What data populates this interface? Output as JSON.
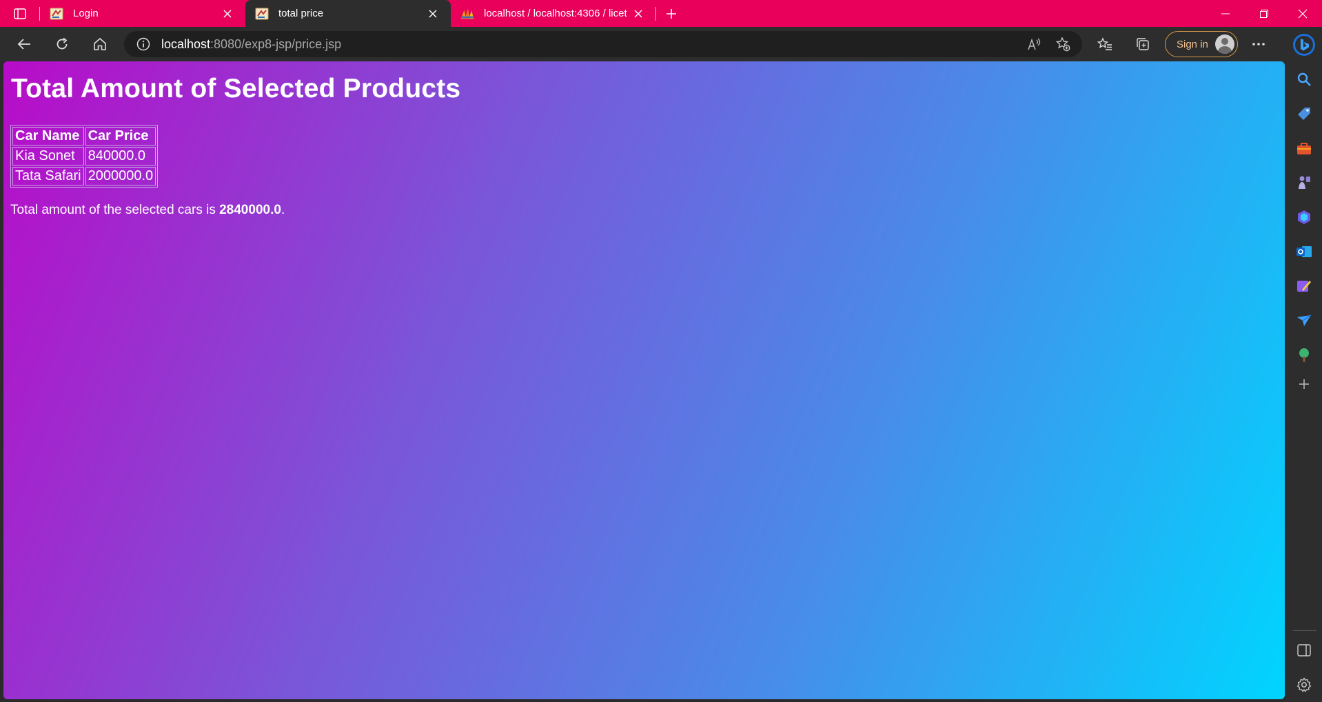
{
  "browser": {
    "tabs": [
      {
        "title": "Login",
        "favicon": "java-cup-icon",
        "active": false
      },
      {
        "title": "total price",
        "favicon": "java-cup-icon",
        "active": true
      },
      {
        "title": "localhost / localhost:4306 / licet /",
        "favicon": "phpmyadmin-icon",
        "active": false
      }
    ],
    "address": {
      "host": "localhost",
      "path": ":8080/exp8-jsp/price.jsp"
    },
    "signin_label": "Sign in",
    "colors": {
      "tabstrip": "#e8005b",
      "toolbar": "#2d2d2d",
      "gradient_start": "#b80cc8",
      "gradient_end": "#00d4ff"
    }
  },
  "page": {
    "heading": "Total Amount of Selected Products",
    "table": {
      "headers": [
        "Car Name",
        "Car Price"
      ],
      "rows": [
        [
          "Kia Sonet",
          "840000.0"
        ],
        [
          "Tata Safari",
          "2000000.0"
        ]
      ]
    },
    "total": {
      "prefix": "Total amount of the selected cars is ",
      "amount": "2840000.0",
      "suffix": "."
    }
  },
  "sidebar": {
    "items": [
      "search-icon",
      "tag-icon",
      "toolbox-icon",
      "games-icon",
      "copilot-icon",
      "outlook-icon",
      "designer-icon",
      "send-icon",
      "tree-icon",
      "add-icon"
    ],
    "bottom": [
      "sidebar-toggle-icon",
      "settings-icon"
    ]
  }
}
